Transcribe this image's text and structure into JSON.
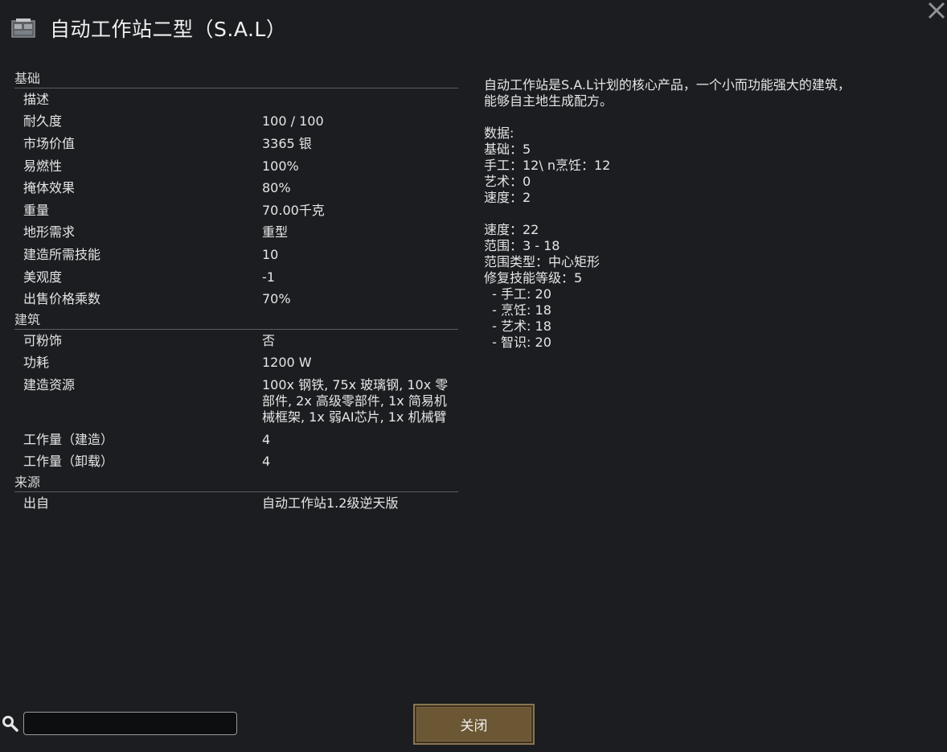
{
  "window": {
    "title": "自动工作站二型（S.A.L）"
  },
  "categories": [
    {
      "name": "基础",
      "rows": [
        {
          "label": "描述",
          "value": ""
        },
        {
          "label": "耐久度",
          "value": "100 / 100"
        },
        {
          "label": "市场价值",
          "value": "3365 银"
        },
        {
          "label": "易燃性",
          "value": "100%"
        },
        {
          "label": "掩体效果",
          "value": "80%"
        },
        {
          "label": "重量",
          "value": "70.00千克"
        },
        {
          "label": "地形需求",
          "value": "重型"
        },
        {
          "label": "建造所需技能",
          "value": "10"
        },
        {
          "label": "美观度",
          "value": "-1"
        },
        {
          "label": "出售价格乘数",
          "value": "70%"
        }
      ]
    },
    {
      "name": "建筑",
      "rows": [
        {
          "label": "可粉饰",
          "value": "否"
        },
        {
          "label": "功耗",
          "value": "1200 W"
        },
        {
          "label": "建造资源",
          "value": "100x 钢铁, 75x 玻璃钢, 10x 零部件, 2x 高级零部件, 1x 简易机械框架, 1x 弱AI芯片, 1x 机械臂"
        },
        {
          "label": "工作量（建造）",
          "value": "4"
        },
        {
          "label": "工作量（卸载）",
          "value": "4"
        }
      ]
    },
    {
      "name": "来源",
      "rows": [
        {
          "label": "出自",
          "value": "自动工作站1.2级逆天版"
        }
      ]
    }
  ],
  "description": "自动工作站是S.A.L计划的核心产品，一个小而功能强大的建筑，\n能够自主地生成配方。\n\n数据:\n基础：5\n手工：12\\ n烹饪：12\n艺术：0\n速度：2\n\n速度：22\n范围：3 - 18\n范围类型：中心矩形\n修复技能等级：5\n  - 手工: 20\n  - 烹饪: 18\n  - 艺术: 18\n  - 智识: 20",
  "search": {
    "value": "",
    "placeholder": ""
  },
  "buttons": {
    "close_label": "关闭"
  },
  "colors": {
    "background": "#1b1d20",
    "button_fill": "#6b5733"
  },
  "icons": {
    "title": "workbench-icon",
    "close": "close-icon",
    "search": "search-icon"
  }
}
